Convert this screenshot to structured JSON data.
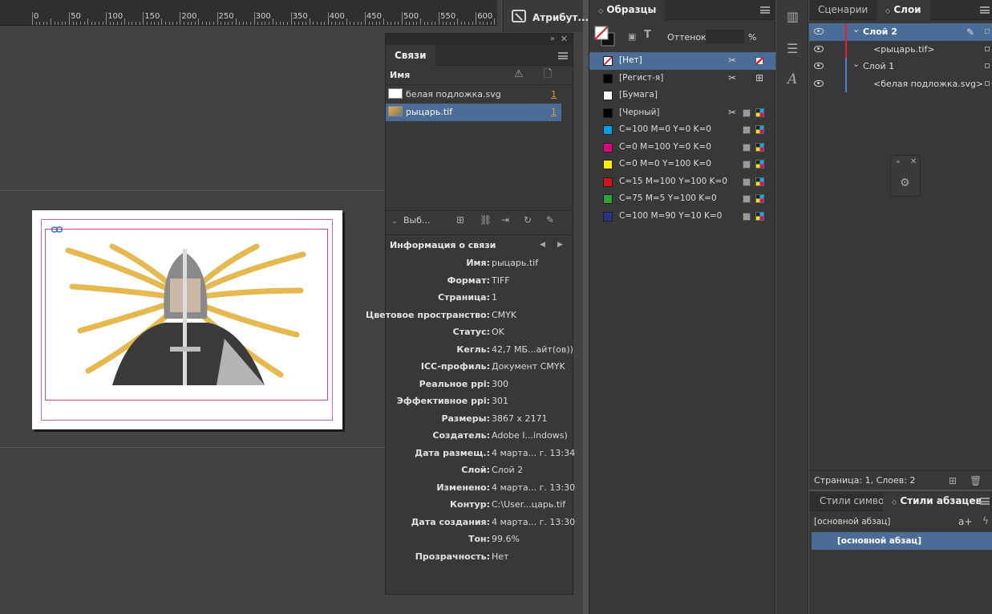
{
  "ruler": {
    "labels": [
      "0",
      "50",
      "100",
      "150",
      "200",
      "250",
      "300",
      "350",
      "400",
      "450",
      "500",
      "550",
      "600"
    ]
  },
  "attributes_button": {
    "label": "Атрибут..."
  },
  "links_panel": {
    "tab": "Связи",
    "column_name": "Имя",
    "links": [
      {
        "name": "белая подложка.svg",
        "count": "1"
      },
      {
        "name": "рыцарь.tif",
        "count": "1",
        "selected": true
      }
    ],
    "selection_label": "Выб...",
    "info_title": "Информация о связи",
    "info": [
      {
        "key": "Имя:",
        "value": "рыцарь.tif"
      },
      {
        "key": "Формат:",
        "value": "TIFF"
      },
      {
        "key": "Страница:",
        "value": "1"
      },
      {
        "key": "Цветовое пространство:",
        "value": "CMYK"
      },
      {
        "key": "Статус:",
        "value": "OK"
      },
      {
        "key": "Кегль:",
        "value": "42,7 МБ...айт(ов))"
      },
      {
        "key": "ICC-профиль:",
        "value": "Документ CMYK"
      },
      {
        "key": "Реальное ppi:",
        "value": "300"
      },
      {
        "key": "Эффективное ppi:",
        "value": "301"
      },
      {
        "key": "Размеры:",
        "value": "3867 x 2171"
      },
      {
        "key": "Создатель:",
        "value": "Adobe I...indows)"
      },
      {
        "key": "Дата размещ.:",
        "value": "4 марта... г. 13:34"
      },
      {
        "key": "Слой:",
        "value": "Слой 2"
      },
      {
        "key": "Изменено:",
        "value": "4 марта... г. 13:30"
      },
      {
        "key": "Контур:",
        "value": "C:\\User...царь.tif"
      },
      {
        "key": "Дата создания:",
        "value": "4 марта... г. 13:30"
      },
      {
        "key": "Тон:",
        "value": "99.6%"
      },
      {
        "key": "Прозрачность:",
        "value": "Нет"
      }
    ]
  },
  "swatches_panel": {
    "tab": "Образцы",
    "tint_label": "Оттенок:",
    "tint_unit": "%",
    "swatches": [
      {
        "name": "[Нет]",
        "color": "none",
        "selected": true
      },
      {
        "name": "[Регист-я]",
        "color": "#000000"
      },
      {
        "name": "[Бумага]",
        "color": "#ffffff"
      },
      {
        "name": "[Черный]",
        "color": "#000000"
      },
      {
        "name": "C=100 M=0 Y=0 K=0",
        "color": "#00a0e3"
      },
      {
        "name": "C=0 M=100 Y=0 K=0",
        "color": "#e5007d"
      },
      {
        "name": "C=0 M=0 Y=100 K=0",
        "color": "#ffed00"
      },
      {
        "name": "C=15 M=100 Y=100 K=0",
        "color": "#d4121b"
      },
      {
        "name": "C=75 M=5 Y=100 K=0",
        "color": "#2ea33a"
      },
      {
        "name": "C=100 M=90 Y=10 K=0",
        "color": "#27358b"
      }
    ]
  },
  "layers_panel": {
    "tabs": [
      "Сценарии",
      "Слои"
    ],
    "layers": [
      {
        "name": "Слой 2",
        "type": "layer",
        "color": "#e0232e",
        "selected": true
      },
      {
        "name": "<рыцарь.tif>",
        "type": "item",
        "color": "#e0232e"
      },
      {
        "name": "Слой 1",
        "type": "layer",
        "color": "#4f7fd6"
      },
      {
        "name": "<белая подложка.svg>",
        "type": "item",
        "color": "#4f7fd6"
      }
    ],
    "status": "Страница: 1, Слоев: 2"
  },
  "styles_panel": {
    "tabs": [
      "Стили символ",
      "Стили абзацев"
    ],
    "current": "[основной абзац]",
    "items": [
      "[основной абзац]"
    ]
  }
}
